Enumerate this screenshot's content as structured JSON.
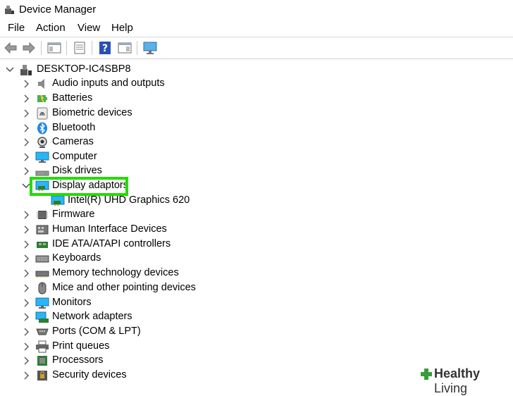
{
  "window": {
    "title": "Device Manager"
  },
  "menu": [
    "File",
    "Action",
    "View",
    "Help"
  ],
  "tree": {
    "root": "DESKTOP-IC4SBP8",
    "categories": [
      "Audio inputs and outputs",
      "Batteries",
      "Biometric devices",
      "Bluetooth",
      "Cameras",
      "Computer",
      "Disk drives",
      "Display adaptors",
      "Firmware",
      "Human Interface Devices",
      "IDE ATA/ATAPI controllers",
      "Keyboards",
      "Memory technology devices",
      "Mice and other pointing devices",
      "Monitors",
      "Network adapters",
      "Ports (COM & LPT)",
      "Print queues",
      "Processors",
      "Security devices"
    ],
    "expanded_child": "Intel(R) UHD Graphics 620"
  },
  "watermark": {
    "brand": "Healthy",
    "brand2": "Living"
  },
  "colors": {
    "highlight": "#22dd00",
    "accent": "#1e88e5"
  }
}
